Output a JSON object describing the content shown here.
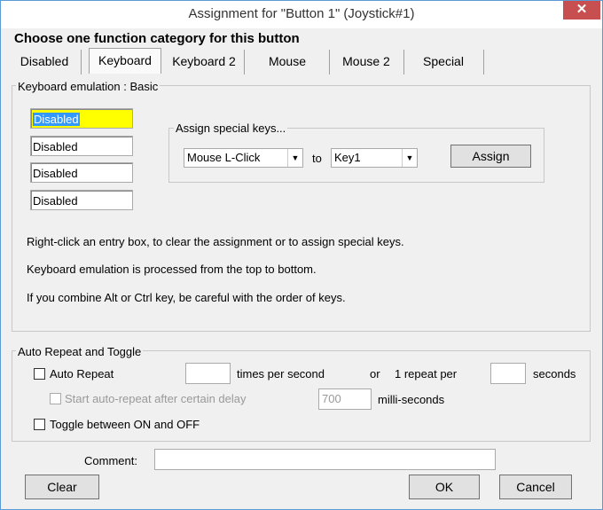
{
  "window": {
    "title": "Assignment for \"Button 1\" (Joystick#1)",
    "close_glyph": "✕"
  },
  "heading": "Choose one function category for this button",
  "tabs": [
    {
      "label": "Disabled"
    },
    {
      "label": "Keyboard"
    },
    {
      "label": "Keyboard 2"
    },
    {
      "label": "Mouse"
    },
    {
      "label": "Mouse 2"
    },
    {
      "label": "Special"
    }
  ],
  "keyboard_group": {
    "label": "Keyboard emulation : Basic",
    "entries": [
      "Disabled",
      "Disabled",
      "Disabled",
      "Disabled"
    ],
    "special": {
      "label": "Assign special keys...",
      "from_value": "Mouse L-Click",
      "to_label": "to",
      "to_value": "Key1",
      "assign_label": "Assign"
    },
    "notes": [
      "Right-click an entry box, to clear the assignment or to assign special keys.",
      "Keyboard emulation is processed from the top to bottom.",
      "If you combine Alt or Ctrl key, be careful with the order of keys."
    ]
  },
  "repeat_group": {
    "label": "Auto Repeat and Toggle",
    "auto_repeat_label": "Auto Repeat",
    "times_per_second": "",
    "times_per_second_label": "times per second",
    "or_label": "or",
    "one_repeat_per_label": "1 repeat per",
    "seconds_value": "",
    "seconds_label": "seconds",
    "delay_label": "Start auto-repeat after certain delay",
    "delay_value": "700",
    "delay_unit": "milli-seconds",
    "toggle_label": "Toggle between ON and OFF"
  },
  "comment": {
    "label": "Comment:",
    "value": ""
  },
  "buttons": {
    "clear": "Clear",
    "ok": "OK",
    "cancel": "Cancel"
  },
  "colors": {
    "highlight": "#ffff00",
    "selection": "#3399ff",
    "close": "#c74f4f"
  }
}
